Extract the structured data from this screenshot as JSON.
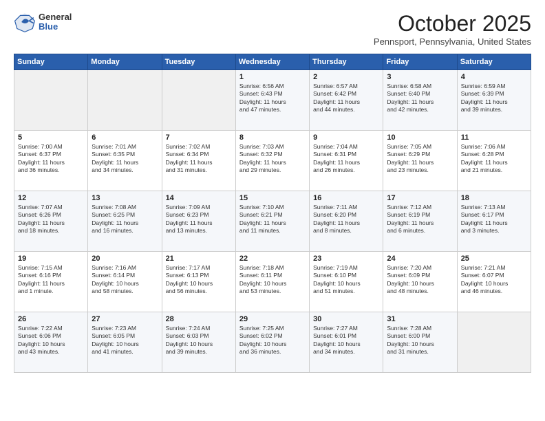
{
  "header": {
    "logo_general": "General",
    "logo_blue": "Blue",
    "month_title": "October 2025",
    "location": "Pennsport, Pennsylvania, United States"
  },
  "weekdays": [
    "Sunday",
    "Monday",
    "Tuesday",
    "Wednesday",
    "Thursday",
    "Friday",
    "Saturday"
  ],
  "weeks": [
    [
      {
        "day": "",
        "info": ""
      },
      {
        "day": "",
        "info": ""
      },
      {
        "day": "",
        "info": ""
      },
      {
        "day": "1",
        "info": "Sunrise: 6:56 AM\nSunset: 6:43 PM\nDaylight: 11 hours\nand 47 minutes."
      },
      {
        "day": "2",
        "info": "Sunrise: 6:57 AM\nSunset: 6:42 PM\nDaylight: 11 hours\nand 44 minutes."
      },
      {
        "day": "3",
        "info": "Sunrise: 6:58 AM\nSunset: 6:40 PM\nDaylight: 11 hours\nand 42 minutes."
      },
      {
        "day": "4",
        "info": "Sunrise: 6:59 AM\nSunset: 6:39 PM\nDaylight: 11 hours\nand 39 minutes."
      }
    ],
    [
      {
        "day": "5",
        "info": "Sunrise: 7:00 AM\nSunset: 6:37 PM\nDaylight: 11 hours\nand 36 minutes."
      },
      {
        "day": "6",
        "info": "Sunrise: 7:01 AM\nSunset: 6:35 PM\nDaylight: 11 hours\nand 34 minutes."
      },
      {
        "day": "7",
        "info": "Sunrise: 7:02 AM\nSunset: 6:34 PM\nDaylight: 11 hours\nand 31 minutes."
      },
      {
        "day": "8",
        "info": "Sunrise: 7:03 AM\nSunset: 6:32 PM\nDaylight: 11 hours\nand 29 minutes."
      },
      {
        "day": "9",
        "info": "Sunrise: 7:04 AM\nSunset: 6:31 PM\nDaylight: 11 hours\nand 26 minutes."
      },
      {
        "day": "10",
        "info": "Sunrise: 7:05 AM\nSunset: 6:29 PM\nDaylight: 11 hours\nand 23 minutes."
      },
      {
        "day": "11",
        "info": "Sunrise: 7:06 AM\nSunset: 6:28 PM\nDaylight: 11 hours\nand 21 minutes."
      }
    ],
    [
      {
        "day": "12",
        "info": "Sunrise: 7:07 AM\nSunset: 6:26 PM\nDaylight: 11 hours\nand 18 minutes."
      },
      {
        "day": "13",
        "info": "Sunrise: 7:08 AM\nSunset: 6:25 PM\nDaylight: 11 hours\nand 16 minutes."
      },
      {
        "day": "14",
        "info": "Sunrise: 7:09 AM\nSunset: 6:23 PM\nDaylight: 11 hours\nand 13 minutes."
      },
      {
        "day": "15",
        "info": "Sunrise: 7:10 AM\nSunset: 6:21 PM\nDaylight: 11 hours\nand 11 minutes."
      },
      {
        "day": "16",
        "info": "Sunrise: 7:11 AM\nSunset: 6:20 PM\nDaylight: 11 hours\nand 8 minutes."
      },
      {
        "day": "17",
        "info": "Sunrise: 7:12 AM\nSunset: 6:19 PM\nDaylight: 11 hours\nand 6 minutes."
      },
      {
        "day": "18",
        "info": "Sunrise: 7:13 AM\nSunset: 6:17 PM\nDaylight: 11 hours\nand 3 minutes."
      }
    ],
    [
      {
        "day": "19",
        "info": "Sunrise: 7:15 AM\nSunset: 6:16 PM\nDaylight: 11 hours\nand 1 minute."
      },
      {
        "day": "20",
        "info": "Sunrise: 7:16 AM\nSunset: 6:14 PM\nDaylight: 10 hours\nand 58 minutes."
      },
      {
        "day": "21",
        "info": "Sunrise: 7:17 AM\nSunset: 6:13 PM\nDaylight: 10 hours\nand 56 minutes."
      },
      {
        "day": "22",
        "info": "Sunrise: 7:18 AM\nSunset: 6:11 PM\nDaylight: 10 hours\nand 53 minutes."
      },
      {
        "day": "23",
        "info": "Sunrise: 7:19 AM\nSunset: 6:10 PM\nDaylight: 10 hours\nand 51 minutes."
      },
      {
        "day": "24",
        "info": "Sunrise: 7:20 AM\nSunset: 6:09 PM\nDaylight: 10 hours\nand 48 minutes."
      },
      {
        "day": "25",
        "info": "Sunrise: 7:21 AM\nSunset: 6:07 PM\nDaylight: 10 hours\nand 46 minutes."
      }
    ],
    [
      {
        "day": "26",
        "info": "Sunrise: 7:22 AM\nSunset: 6:06 PM\nDaylight: 10 hours\nand 43 minutes."
      },
      {
        "day": "27",
        "info": "Sunrise: 7:23 AM\nSunset: 6:05 PM\nDaylight: 10 hours\nand 41 minutes."
      },
      {
        "day": "28",
        "info": "Sunrise: 7:24 AM\nSunset: 6:03 PM\nDaylight: 10 hours\nand 39 minutes."
      },
      {
        "day": "29",
        "info": "Sunrise: 7:25 AM\nSunset: 6:02 PM\nDaylight: 10 hours\nand 36 minutes."
      },
      {
        "day": "30",
        "info": "Sunrise: 7:27 AM\nSunset: 6:01 PM\nDaylight: 10 hours\nand 34 minutes."
      },
      {
        "day": "31",
        "info": "Sunrise: 7:28 AM\nSunset: 6:00 PM\nDaylight: 10 hours\nand 31 minutes."
      },
      {
        "day": "",
        "info": ""
      }
    ]
  ]
}
